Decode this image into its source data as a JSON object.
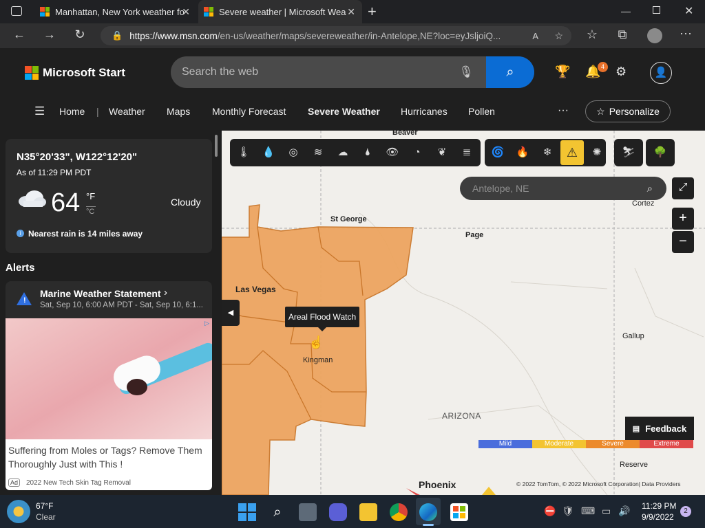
{
  "browser": {
    "tabs": [
      {
        "title": "Manhattan, New York weather fo",
        "active": false
      },
      {
        "title": "Severe weather | Microsoft Wea",
        "active": true
      }
    ],
    "url_domain": "https://www.msn.com",
    "url_path": "/en-us/weather/maps/severeweather/in-Antelope,NE?loc=eyJsljoiQ..."
  },
  "site": {
    "logo_text": "Microsoft Start",
    "search_placeholder": "Search the web",
    "notification_count": "4",
    "nav": [
      "Home",
      "Weather",
      "Maps",
      "Monthly Forecast",
      "Severe Weather",
      "Hurricanes",
      "Pollen"
    ],
    "personalize_label": "Personalize",
    "more_label": "···"
  },
  "weather_card": {
    "coords": "N35°20'33\", W122°12'20\"",
    "as_of": "As of 11:29 PM PDT",
    "temp": "64",
    "unit_f": "°F",
    "unit_c": "°C",
    "condition": "Cloudy",
    "rain_note": "Nearest rain is 14 miles away"
  },
  "alerts": {
    "heading": "Alerts",
    "items": [
      {
        "title": "Marine Weather Statement",
        "time": "Sat, Sep 10, 6:00 AM PDT - Sat, Sep 10, 6:1..."
      }
    ]
  },
  "ad": {
    "headline": "Suffering from Moles or Tags? Remove Them Thoroughly Just with This !",
    "badge": "Ad",
    "source": "2022 New Tech Skin Tag Removal"
  },
  "map": {
    "search_placeholder": "Antelope, NE",
    "tooltip": "Areal Flood Watch",
    "cities": [
      "Beaver",
      "St George",
      "Page",
      "Cortez",
      "Las Vegas",
      "Kingman",
      "Gallup",
      "ARIZONA",
      "Reserve",
      "Phoenix"
    ],
    "feedback_label": "Feedback",
    "legend": [
      {
        "label": "Mild",
        "color": "#4a6ddc"
      },
      {
        "label": "Moderate",
        "color": "#f3c431"
      },
      {
        "label": "Severe",
        "color": "#ec8a2c"
      },
      {
        "label": "Extreme",
        "color": "#e04a4a"
      }
    ],
    "copyright": "© 2022 TomTom, © 2022 Microsoft Corporation| Data Providers",
    "zoom_in": "+",
    "zoom_out": "−"
  },
  "taskbar": {
    "weather_temp": "67°F",
    "weather_cond": "Clear",
    "time": "11:29 PM",
    "date": "9/9/2022",
    "notif_count": "2"
  },
  "colors": {
    "accent": "#0b6cd4",
    "flood": "#eda560",
    "flood_border": "#c9762a"
  }
}
